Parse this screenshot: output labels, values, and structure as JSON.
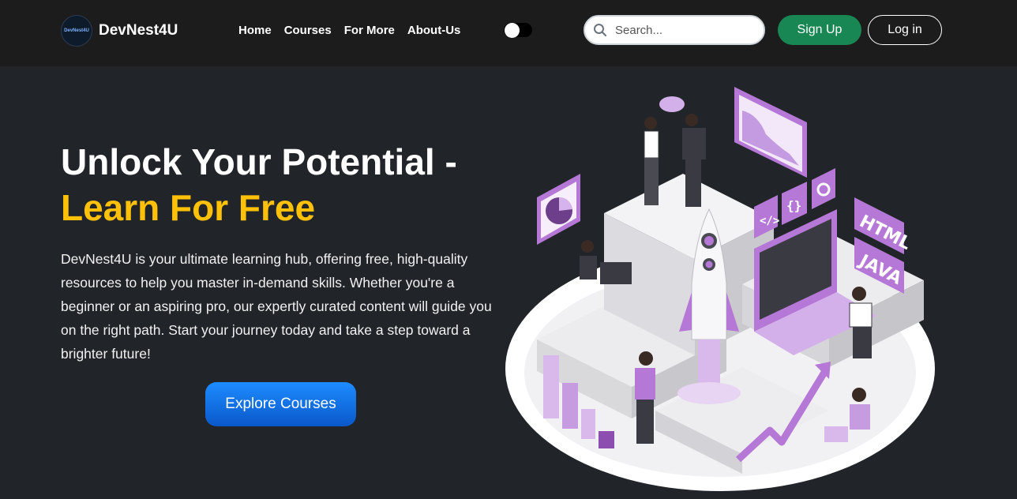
{
  "brand": {
    "name": "DevNest4U",
    "logo_text": "DevNest4U"
  },
  "nav": {
    "links": [
      "Home",
      "Courses",
      "For More",
      "About-Us"
    ]
  },
  "theme_toggle": {
    "state": "dark"
  },
  "search": {
    "placeholder": "Search..."
  },
  "auth": {
    "signup_label": "Sign Up",
    "login_label": "Log in"
  },
  "hero": {
    "title_line1": "Unlock Your Potential -",
    "title_line2": "Learn For Free",
    "description": "DevNest4U is your ultimate learning hub, offering free, high-quality resources to help you master in-demand skills. Whether you're a beginner or an aspiring pro, our expertly curated content will guide you on the right path. Start your journey today and take a step toward a brighter future!",
    "cta_label": "Explore Courses"
  },
  "illustration": {
    "badges": [
      "HTML",
      "JAVA"
    ]
  },
  "colors": {
    "background": "#212529",
    "navbar": "#1c1c1c",
    "accent_yellow": "#ffc107",
    "signup_green": "#198754",
    "cta_blue": "#0d6efd",
    "illustration_purple": "#b678d6"
  }
}
